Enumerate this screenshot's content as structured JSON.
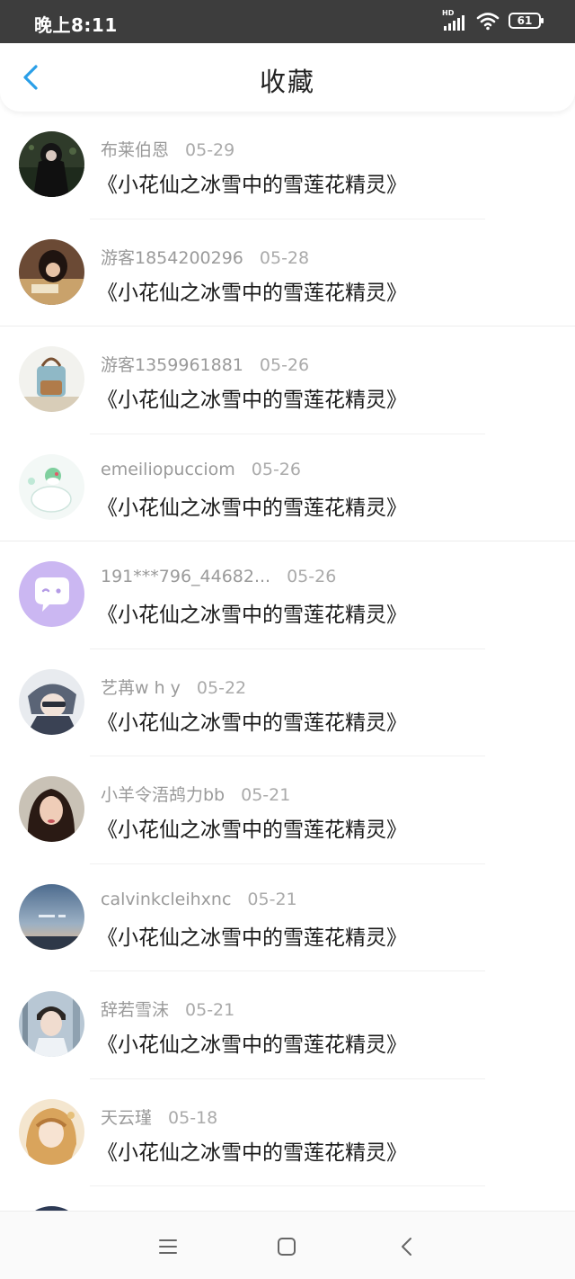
{
  "status": {
    "time": "晚上8:11",
    "network": "HD",
    "battery": "61"
  },
  "header": {
    "title": "收藏"
  },
  "colors": {
    "accent": "#2a9fe8",
    "status_bar": "#3d3d3d"
  },
  "items": [
    {
      "user": "布莱伯恩",
      "date": "05-29",
      "title": "《小花仙之冰雪中的雪莲花精灵》"
    },
    {
      "user": "游客1854200296",
      "date": "05-28",
      "title": "《小花仙之冰雪中的雪莲花精灵》"
    },
    {
      "user": "游客1359961881",
      "date": "05-26",
      "title": "《小花仙之冰雪中的雪莲花精灵》"
    },
    {
      "user": "emeiliopucciom",
      "date": "05-26",
      "title": "《小花仙之冰雪中的雪莲花精灵》"
    },
    {
      "user": "191***796_44682...",
      "date": "05-26",
      "title": "《小花仙之冰雪中的雪莲花精灵》"
    },
    {
      "user": "艺苒w h y",
      "date": "05-22",
      "title": "《小花仙之冰雪中的雪莲花精灵》"
    },
    {
      "user": "小羊令浯鸪力bb",
      "date": "05-21",
      "title": "《小花仙之冰雪中的雪莲花精灵》"
    },
    {
      "user": "calvinkcleihxnc",
      "date": "05-21",
      "title": "《小花仙之冰雪中的雪莲花精灵》"
    },
    {
      "user": "辞若雪沫",
      "date": "05-21",
      "title": "《小花仙之冰雪中的雪莲花精灵》"
    },
    {
      "user": "天云瑾",
      "date": "05-18",
      "title": "《小花仙之冰雪中的雪莲花精灵》"
    }
  ]
}
